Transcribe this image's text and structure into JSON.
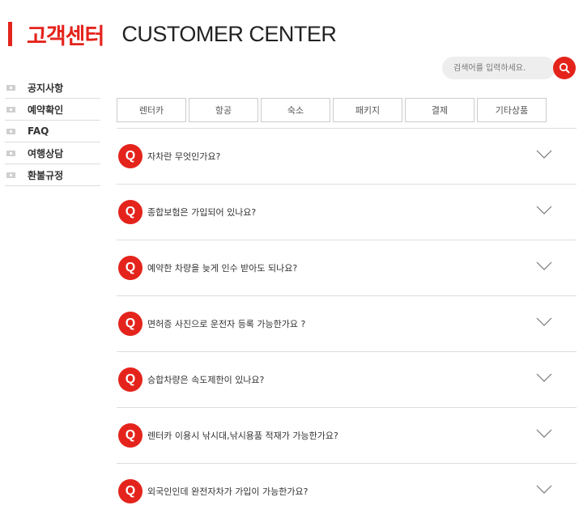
{
  "header": {
    "title_ko": "고객센터",
    "title_en": "CUSTOMER CENTER"
  },
  "search": {
    "placeholder": "검색어를 입력하세요."
  },
  "sidebar": {
    "items": [
      {
        "label": "공지사항"
      },
      {
        "label": "예약확인"
      },
      {
        "label": "FAQ"
      },
      {
        "label": "여행상담"
      },
      {
        "label": "환불규정"
      }
    ]
  },
  "tabs": [
    {
      "label": "렌터카"
    },
    {
      "label": "항공"
    },
    {
      "label": "숙소"
    },
    {
      "label": "패키지"
    },
    {
      "label": "결제"
    },
    {
      "label": "기타상품"
    }
  ],
  "faq": {
    "badge": "Q",
    "items": [
      {
        "question": "자차란 무엇인가요?"
      },
      {
        "question": "종합보험은 가입되어 있나요?"
      },
      {
        "question": "예약한 차량을 늦게 인수 받아도 되나요?"
      },
      {
        "question": "면허증 사진으로 운전자 등록 가능한가요 ?"
      },
      {
        "question": "승합차량은 속도제한이 있나요?"
      },
      {
        "question": "렌터카 이용시 낚시대,낚시용품 적재가 가능한가요?"
      },
      {
        "question": "외국인인데 완전자차가 가입이 가능한가요?"
      }
    ]
  },
  "colors": {
    "accent": "#e4241c",
    "divider": "#dddddd"
  },
  "icons": {
    "search": "search-icon",
    "expand": "chevron-down-icon",
    "bullet": "sidebar-bullet-icon"
  }
}
